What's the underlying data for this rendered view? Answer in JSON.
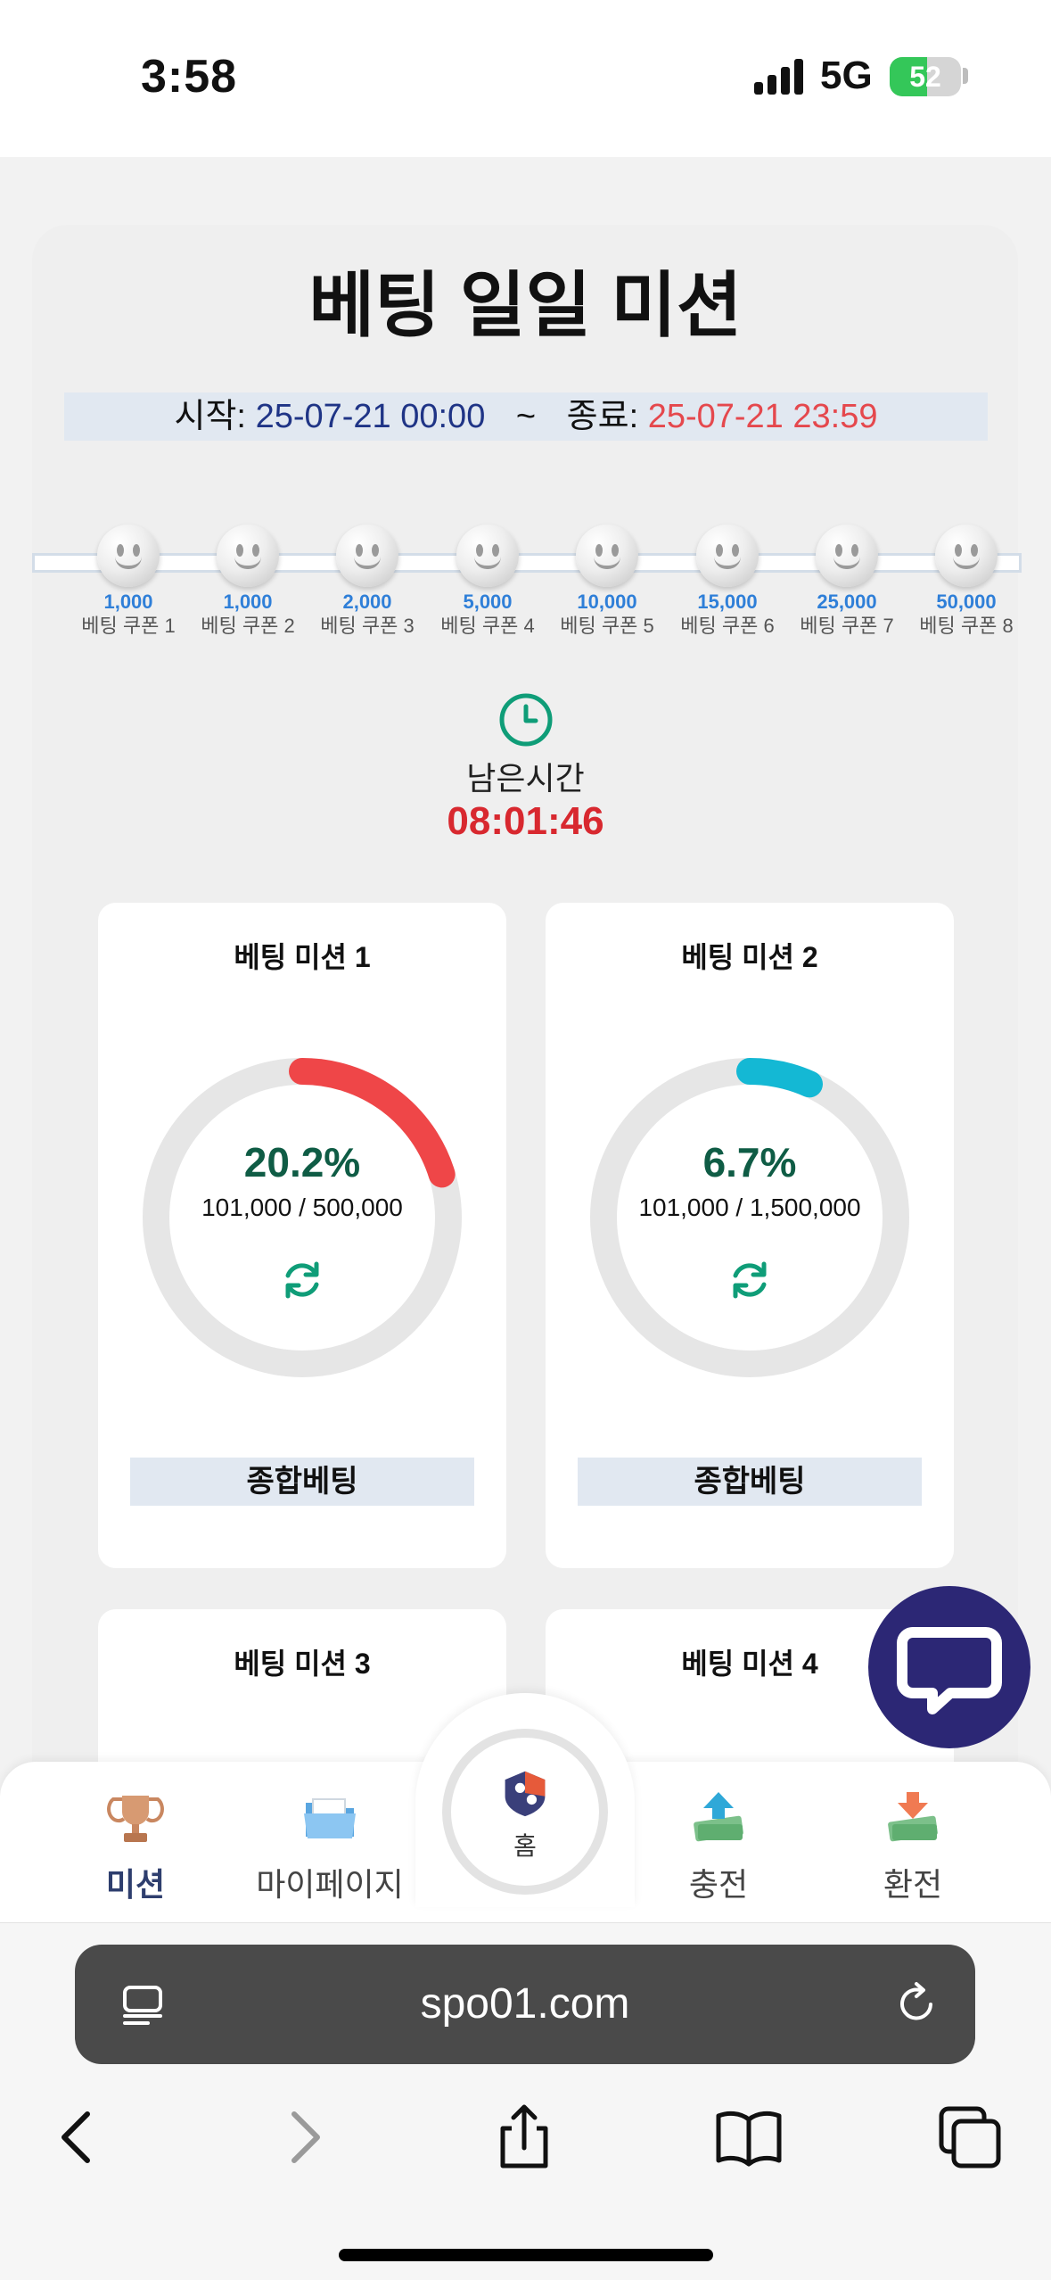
{
  "status_bar": {
    "time": "3:58",
    "network": "5G",
    "battery": "52",
    "battery_level": 0.52
  },
  "page": {
    "title": "베팅 일일 미션",
    "period": {
      "start_label": "시작:",
      "start_value": "25-07-21 00:00",
      "separator": "~",
      "end_label": "종료:",
      "end_value": "25-07-21 23:59"
    },
    "coupons": [
      {
        "amount": "1,000",
        "name": "베팅 쿠폰 1"
      },
      {
        "amount": "1,000",
        "name": "베팅 쿠폰 2"
      },
      {
        "amount": "2,000",
        "name": "베팅 쿠폰 3"
      },
      {
        "amount": "5,000",
        "name": "베팅 쿠폰 4"
      },
      {
        "amount": "10,000",
        "name": "베팅 쿠폰 5"
      },
      {
        "amount": "15,000",
        "name": "베팅 쿠폰 6"
      },
      {
        "amount": "25,000",
        "name": "베팅 쿠폰 7"
      },
      {
        "amount": "50,000",
        "name": "베팅 쿠폰 8"
      }
    ],
    "remaining": {
      "label": "남은시간",
      "time": "08:01:46"
    },
    "missions": [
      {
        "title": "베팅 미션 1",
        "percent": "20.2%",
        "progress": 0.202,
        "amount": "101,000 / 500,000",
        "button": "종합베팅",
        "color": "#ef4648"
      },
      {
        "title": "베팅 미션 2",
        "percent": "6.7%",
        "progress": 0.067,
        "amount": "101,000 / 1,500,000",
        "button": "종합베팅",
        "color": "#14b8d4"
      },
      {
        "title": "베팅 미션 3"
      },
      {
        "title": "베팅 미션 4"
      }
    ]
  },
  "bottom_nav": {
    "mission": "미션",
    "mypage": "마이페이지",
    "home": "홈",
    "deposit": "충전",
    "withdraw": "환전"
  },
  "browser": {
    "url": "spo01.com"
  },
  "colors": {
    "accent_navy": "#2c2775",
    "teal": "#0f9d78",
    "red": "#d8282f"
  }
}
